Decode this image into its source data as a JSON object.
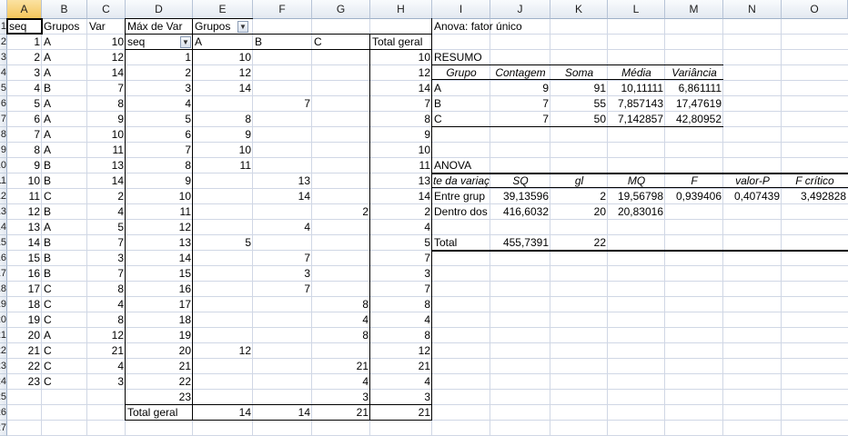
{
  "columns": [
    "A",
    "B",
    "C",
    "D",
    "E",
    "F",
    "G",
    "H",
    "I",
    "J",
    "K",
    "L",
    "M",
    "N",
    "O"
  ],
  "rows": [
    "1",
    "2",
    "3",
    "4",
    "5",
    "6",
    "7",
    "8",
    "9",
    "10",
    "11",
    "12",
    "13",
    "14",
    "15",
    "16",
    "17",
    "18",
    "19",
    "20",
    "21",
    "22",
    "23",
    "24",
    "25",
    "26",
    "27"
  ],
  "source": {
    "headers": [
      "seq",
      "Grupos",
      "Var"
    ],
    "data": [
      [
        "1",
        "A",
        "10"
      ],
      [
        "2",
        "A",
        "12"
      ],
      [
        "3",
        "A",
        "14"
      ],
      [
        "4",
        "B",
        "7"
      ],
      [
        "5",
        "A",
        "8"
      ],
      [
        "6",
        "A",
        "9"
      ],
      [
        "7",
        "A",
        "10"
      ],
      [
        "8",
        "A",
        "11"
      ],
      [
        "9",
        "B",
        "13"
      ],
      [
        "10",
        "B",
        "14"
      ],
      [
        "11",
        "C",
        "2"
      ],
      [
        "12",
        "B",
        "4"
      ],
      [
        "13",
        "A",
        "5"
      ],
      [
        "14",
        "B",
        "7"
      ],
      [
        "15",
        "B",
        "3"
      ],
      [
        "16",
        "B",
        "7"
      ],
      [
        "17",
        "C",
        "8"
      ],
      [
        "18",
        "C",
        "4"
      ],
      [
        "19",
        "C",
        "8"
      ],
      [
        "20",
        "A",
        "12"
      ],
      [
        "21",
        "C",
        "21"
      ],
      [
        "22",
        "C",
        "4"
      ],
      [
        "23",
        "C",
        "3"
      ]
    ]
  },
  "pivot": {
    "title": "Máx de Var",
    "col_field": "Grupos",
    "row_field": "seq",
    "col_labels": [
      "A",
      "B",
      "C"
    ],
    "total_col_label": "Total geral",
    "total_row_label": "Total geral",
    "dropdown_glyph": "▼",
    "rows": [
      [
        "1",
        "10",
        "",
        "",
        "10"
      ],
      [
        "2",
        "12",
        "",
        "",
        "12"
      ],
      [
        "3",
        "14",
        "",
        "",
        "14"
      ],
      [
        "4",
        "",
        "7",
        "",
        "7"
      ],
      [
        "5",
        "8",
        "",
        "",
        "8"
      ],
      [
        "6",
        "9",
        "",
        "",
        "9"
      ],
      [
        "7",
        "10",
        "",
        "",
        "10"
      ],
      [
        "8",
        "11",
        "",
        "",
        "11"
      ],
      [
        "9",
        "",
        "13",
        "",
        "13"
      ],
      [
        "10",
        "",
        "14",
        "",
        "14"
      ],
      [
        "11",
        "",
        "",
        "2",
        "2"
      ],
      [
        "12",
        "",
        "4",
        "",
        "4"
      ],
      [
        "13",
        "5",
        "",
        "",
        "5"
      ],
      [
        "14",
        "",
        "7",
        "",
        "7"
      ],
      [
        "15",
        "",
        "3",
        "",
        "3"
      ],
      [
        "16",
        "",
        "7",
        "",
        "7"
      ],
      [
        "17",
        "",
        "",
        "8",
        "8"
      ],
      [
        "18",
        "",
        "",
        "4",
        "4"
      ],
      [
        "19",
        "",
        "",
        "8",
        "8"
      ],
      [
        "20",
        "12",
        "",
        "",
        "12"
      ],
      [
        "21",
        "",
        "",
        "21",
        "21"
      ],
      [
        "22",
        "",
        "",
        "4",
        "4"
      ],
      [
        "23",
        "",
        "",
        "3",
        "3"
      ]
    ],
    "totals": [
      "14",
      "14",
      "21",
      "21"
    ]
  },
  "anova": {
    "title": "Anova: fator único",
    "resumo_label": "RESUMO",
    "resumo_headers": [
      "Grupo",
      "Contagem",
      "Soma",
      "Média",
      "Variância"
    ],
    "resumo_rows": [
      [
        "A",
        "9",
        "91",
        "10,11111",
        "6,861111"
      ],
      [
        "B",
        "7",
        "55",
        "7,857143",
        "17,47619"
      ],
      [
        "C",
        "7",
        "50",
        "7,142857",
        "42,80952"
      ]
    ],
    "anova_label": "ANOVA",
    "anova_headers": [
      "te da variaç",
      "SQ",
      "gl",
      "MQ",
      "F",
      "valor-P",
      "F crítico"
    ],
    "anova_rows": [
      [
        "Entre grup",
        "39,13596",
        "2",
        "19,56798",
        "0,939406",
        "0,407439",
        "3,492828"
      ],
      [
        "Dentro dos",
        "416,6032",
        "20",
        "20,83016",
        "",
        "",
        ""
      ]
    ],
    "total_row": [
      "Total",
      "455,7391",
      "22"
    ]
  }
}
